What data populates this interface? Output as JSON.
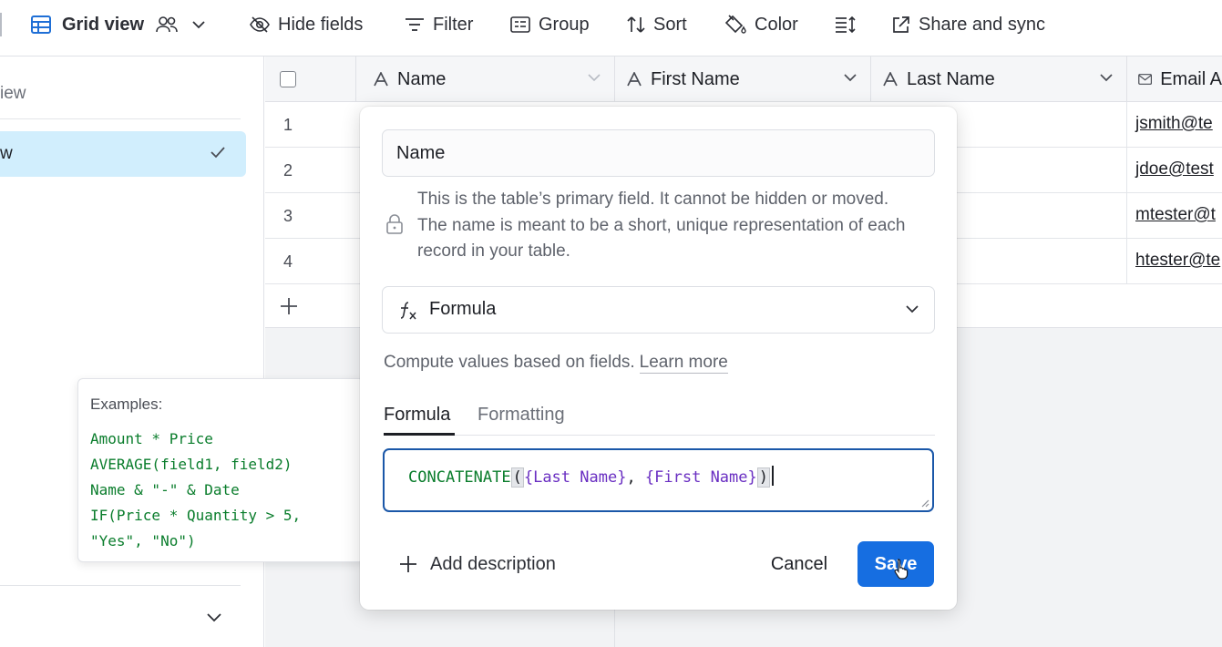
{
  "toolbar": {
    "view_name": "Grid view",
    "hide_fields": "Hide fields",
    "filter": "Filter",
    "group": "Group",
    "sort": "Sort",
    "color": "Color",
    "share_sync": "Share and sync"
  },
  "sidebar": {
    "heading": "iew",
    "active_item": "w"
  },
  "grid": {
    "columns": [
      "Name",
      "First Name",
      "Last Name",
      "Email A"
    ],
    "rows": [
      {
        "num": "1",
        "email": "jsmith@te"
      },
      {
        "num": "2",
        "email": "jdoe@test"
      },
      {
        "num": "3",
        "email": "mtester@t"
      },
      {
        "num": "4",
        "email": "htester@te"
      }
    ]
  },
  "examples": {
    "title": "Examples:",
    "lines": [
      "Amount * Price",
      "AVERAGE(field1, field2)",
      "Name & \"-\" & Date",
      "IF(Price * Quantity > 5,",
      "\"Yes\", \"No\")"
    ]
  },
  "field_editor": {
    "name_value": "Name",
    "primary_note": "This is the table’s primary field. It cannot be hidden or moved. The name is meant to be a short, unique representation of each record in your table.",
    "field_type": "Formula",
    "compute_text": "Compute values based on fields.",
    "learn_more": "Learn more",
    "tabs": [
      "Formula",
      "Formatting"
    ],
    "formula": {
      "function": "CONCATENATE",
      "open_paren": "(",
      "arg1": "{Last Name}",
      "sep": ", ",
      "arg2": "{First Name}",
      "close_paren": ")"
    },
    "add_description": "Add description",
    "cancel": "Cancel",
    "save": "Save"
  },
  "colors": {
    "accent": "#166ee1",
    "selected_row": "#d1eefd",
    "formula_function": "#0a7d2c",
    "formula_field": "#6a2fc2"
  }
}
